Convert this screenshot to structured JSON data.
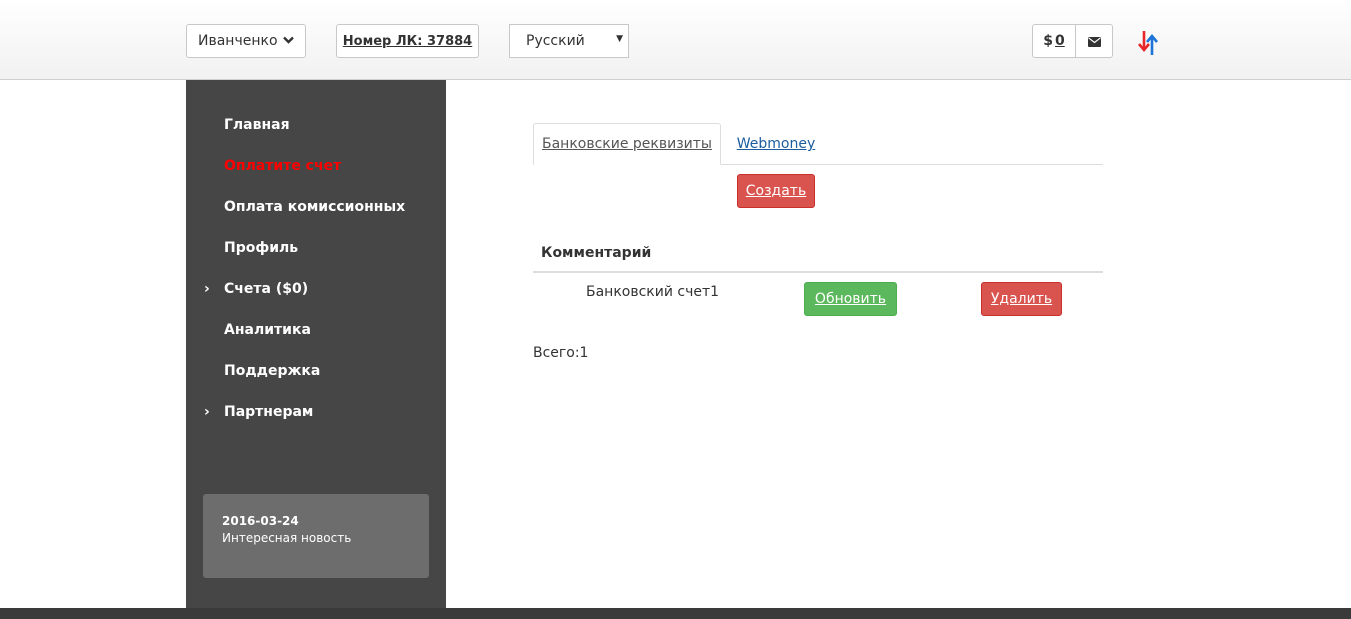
{
  "header": {
    "user_name": "Иванченко",
    "account_number": "Номер ЛК: 37884",
    "language": "Русский",
    "balance_symbol": "$",
    "balance_amount": "0"
  },
  "sidebar": {
    "items": [
      {
        "label": "Главная",
        "active": false,
        "expandable": false
      },
      {
        "label": "Оплатите счет",
        "active": true,
        "expandable": false
      },
      {
        "label": "Оплата комиссионных",
        "active": false,
        "expandable": false
      },
      {
        "label": "Профиль",
        "active": false,
        "expandable": false
      },
      {
        "label": "Счета ($0)",
        "active": false,
        "expandable": true
      },
      {
        "label": "Аналитика",
        "active": false,
        "expandable": false
      },
      {
        "label": "Поддержка",
        "active": false,
        "expandable": false
      },
      {
        "label": "Партнерам",
        "active": false,
        "expandable": true
      }
    ],
    "news": {
      "date": "2016-03-24",
      "text": "Интересная новость"
    }
  },
  "main": {
    "tabs": [
      {
        "label": "Банковские реквизиты",
        "active": true
      },
      {
        "label": "Webmoney",
        "active": false
      }
    ],
    "create_label": "Создать",
    "table": {
      "columns": [
        "Комментарий"
      ],
      "rows": [
        {
          "comment": "Банковский счет1",
          "update_label": "Обновить",
          "delete_label": "Удалить"
        }
      ]
    },
    "total": "Всего:1"
  },
  "colors": {
    "sidebar_bg": "#464646",
    "active_nav": "#ff0000",
    "danger": "#d9534f",
    "success": "#5cb85c",
    "link": "#1a5c9e"
  }
}
